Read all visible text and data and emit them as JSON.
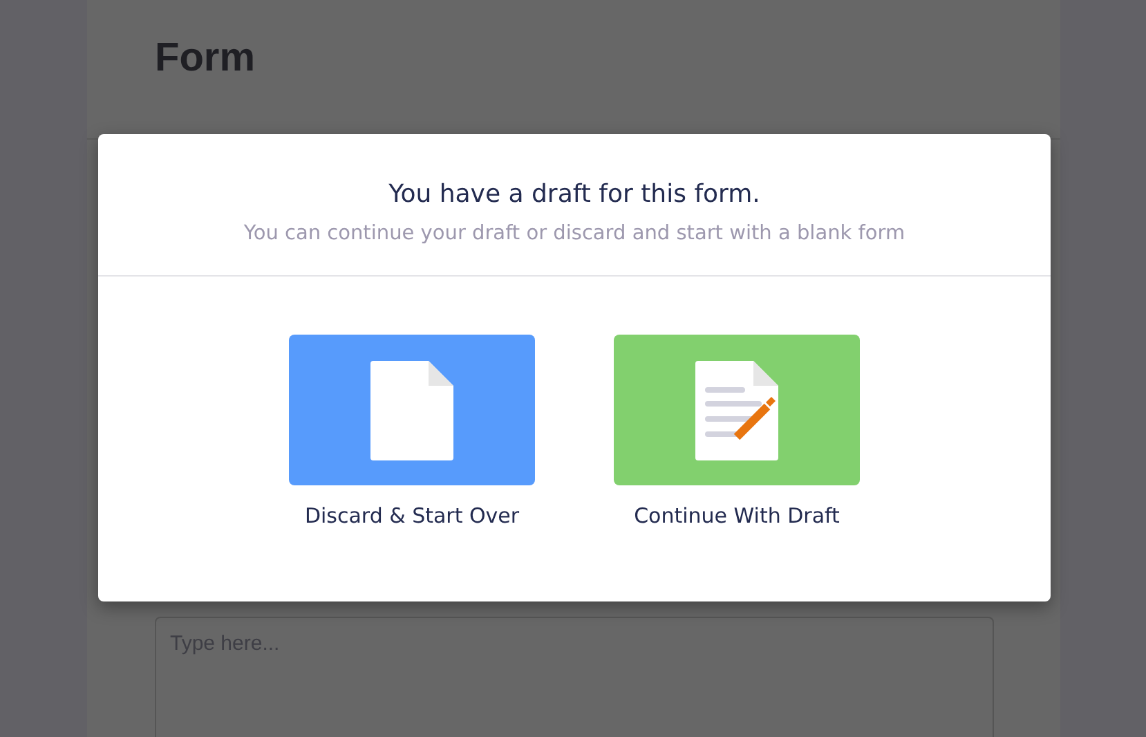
{
  "page": {
    "title": "Form",
    "textarea": {
      "placeholder": "Type here..."
    }
  },
  "dialog": {
    "title": "You have a draft for this form.",
    "subtitle": "You can continue your draft or discard and start with a blank form",
    "options": [
      {
        "kind": "discard",
        "label": "Discard & Start Over",
        "color": "#579bfc"
      },
      {
        "kind": "continue",
        "label": "Continue With Draft",
        "color": "#82d06e"
      }
    ]
  }
}
